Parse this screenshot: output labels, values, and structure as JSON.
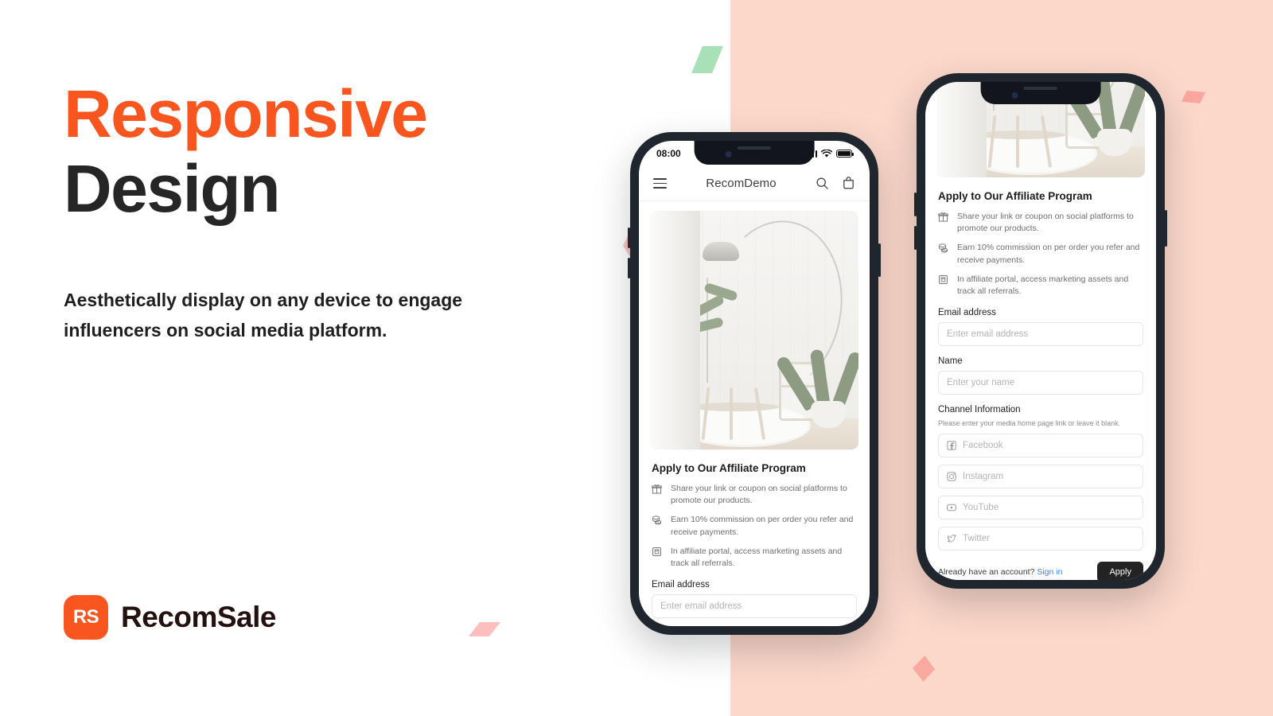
{
  "hero_copy": {
    "headline_accent": "Responsive",
    "headline_dark": "Design",
    "subcopy": "Aesthetically display on any device to engage influencers on social media platform."
  },
  "brand": {
    "mark_text": "RS",
    "name": "RecomSale",
    "accent_color": "#f9551f",
    "name_color": "#241210"
  },
  "theme": {
    "panel_background": "#fcd8ca",
    "page_background": "#ffffff",
    "link_color": "#3b82f6",
    "button_color": "#232323",
    "shape_green": "#a8e0b8",
    "shape_pink": "#f9a99f"
  },
  "phone_left": {
    "statusbar": {
      "time": "08:00",
      "signal_icon": "cellular-bars-icon",
      "wifi_icon": "wifi-icon",
      "battery_icon": "battery-icon"
    },
    "appbar": {
      "menu_icon": "hamburger-menu-icon",
      "title": "RecomDemo",
      "search_icon": "search-icon",
      "cart_icon": "shopping-bag-icon"
    },
    "hero_image_alt": "interior-room-photo",
    "form": {
      "title": "Apply to Our Affiliate Program",
      "benefits": [
        {
          "icon": "gift-icon",
          "text": "Share your link or coupon on social platforms to promote our products."
        },
        {
          "icon": "coins-icon",
          "text": "Earn 10% commission on per order you refer and receive payments."
        },
        {
          "icon": "portal-icon",
          "text": "In affiliate portal, access marketing assets and track all referrals."
        }
      ],
      "email_label": "Email address",
      "email_placeholder": "Enter email address"
    }
  },
  "phone_right": {
    "hero_image_alt": "interior-room-photo-scrolled",
    "form": {
      "title": "Apply to Our Affiliate Program",
      "benefits": [
        {
          "icon": "gift-icon",
          "text": "Share your link or coupon on social platforms to promote our products."
        },
        {
          "icon": "coins-icon",
          "text": "Earn 10% commission on per order you refer and receive payments."
        },
        {
          "icon": "portal-icon",
          "text": "In affiliate portal, access marketing assets and track all referrals."
        }
      ],
      "email_label": "Email address",
      "email_placeholder": "Enter email address",
      "name_label": "Name",
      "name_placeholder": "Enter your name",
      "channel_label": "Channel Information",
      "channel_hint": "Please enter your media home page link or leave it blank.",
      "channels": [
        {
          "icon": "facebook-icon",
          "placeholder": "Facebook"
        },
        {
          "icon": "instagram-icon",
          "placeholder": "Instagram"
        },
        {
          "icon": "youtube-icon",
          "placeholder": "YouTube"
        },
        {
          "icon": "twitter-icon",
          "placeholder": "Twitter"
        }
      ],
      "footer_text": "Already have an account?",
      "signin_link": "Sign in",
      "apply_button": "Apply"
    }
  }
}
